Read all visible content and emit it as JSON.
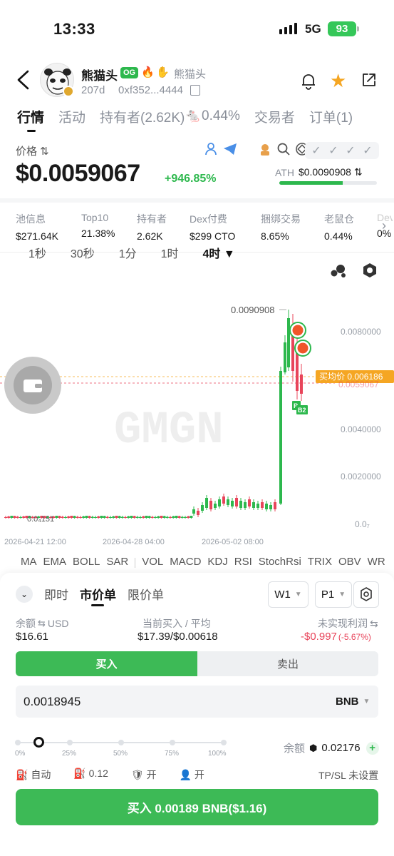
{
  "status_bar": {
    "time": "13:33",
    "network": "5G",
    "battery": "93"
  },
  "header": {
    "token_name": "熊猫头",
    "og_badge": "OG",
    "alias": "熊猫头",
    "age": "207d",
    "address": "0xf352...4444",
    "icons": [
      "back-icon",
      "bell-icon",
      "star-icon",
      "share-icon",
      "copy-icon",
      "fire-icon",
      "hand-icon"
    ]
  },
  "tabs": [
    {
      "label": "行情",
      "active": true
    },
    {
      "label": "活动"
    },
    {
      "label": "持有者(2.62K)"
    },
    {
      "label": "🐁0.44%"
    },
    {
      "label": "交易者"
    },
    {
      "label": "订单(1)"
    }
  ],
  "price": {
    "label": "价格 ⇅",
    "value": "$0.0059067",
    "change": "+946.85%",
    "ath_label": "ATH",
    "ath_value": "$0.0090908 ⇅",
    "ath_fraction": 0.65
  },
  "stats": [
    {
      "key": "池信息",
      "value": "$271.64K"
    },
    {
      "key": "Top10",
      "value": "21.38%",
      "color": "#2db84d"
    },
    {
      "key": "持有者",
      "value": "2.62K"
    },
    {
      "key": "Dex付费",
      "value": "$299 CTO"
    },
    {
      "key": "捆绑交易",
      "value": "8.65%"
    },
    {
      "key": "老鼠仓",
      "value": "0.44%"
    },
    {
      "key": "Dev",
      "value": "0%"
    }
  ],
  "timeframes": [
    "1秒",
    "30秒",
    "1分",
    "1时",
    "4时 ▼"
  ],
  "chart": {
    "high_label": "0.0090908",
    "low_label": "0.0₄151",
    "avg_price_label": "买均价 0.006186",
    "current_label": "0.0059067",
    "y_ticks": [
      "0.0080000",
      "0.0060000",
      "0.0040000",
      "0.0020000",
      "0.0₇"
    ],
    "x_ticks": [
      "2026-04-21 12:00",
      "2026-04-28 04:00",
      "2026-05-02 08:00"
    ],
    "watermark": "GMGN",
    "markers": [
      "P",
      "B2"
    ]
  },
  "indicators_left": [
    "MA",
    "EMA",
    "BOLL",
    "SAR"
  ],
  "indicators_right": [
    "VOL",
    "MACD",
    "KDJ",
    "RSI",
    "StochRsi",
    "TRIX",
    "OBV",
    "WR"
  ],
  "order": {
    "tabs": [
      {
        "label": "即时"
      },
      {
        "label": "市价单",
        "active": true
      },
      {
        "label": "限价单"
      }
    ],
    "wallet_select": "W1",
    "preset_select": "P1",
    "balance_label": "余额",
    "balance_unit": "USD",
    "balance_value": "$16.61",
    "bought_label": "当前买入 / 平均",
    "bought_value": "$17.39/$0.00618",
    "pnl_label": "未实现利润",
    "pnl_value": "-$0.997",
    "pnl_pct": "(-5.67%)",
    "buy_tab": "买入",
    "sell_tab": "卖出",
    "amount": "0.0018945",
    "amount_unit": "BNB",
    "slider_pct_labels": [
      "0%",
      "25%",
      "50%",
      "75%",
      "100%"
    ],
    "slider_value": 0.1,
    "right_balance_label": "余额",
    "right_balance_value": "0.02176",
    "opt_auto": "自动",
    "opt_gas": "0.12",
    "opt_mev": "开",
    "opt_anti": "开",
    "tpsl": "TP/SL 未设置",
    "buy_button": "买入 0.00189 BNB($1.16)"
  }
}
